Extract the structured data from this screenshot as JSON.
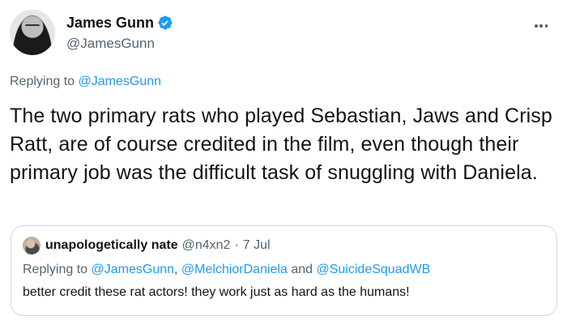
{
  "author": {
    "display_name": "James Gunn",
    "handle": "@JamesGunn",
    "verified": true,
    "avatar_icon": "profile-photo"
  },
  "more_icon": "ellipsis-icon",
  "replying": {
    "prefix": "Replying to",
    "to": "@JamesGunn"
  },
  "tweet": {
    "text": "The two primary rats who played Sebastian, Jaws and Crisp Ratt, are of course credited in the film, even though their primary job was the difficult task of snuggling with Daniela."
  },
  "quote": {
    "display_name": "unapologetically nate",
    "handle": "@n4xn2",
    "separator": "·",
    "date": "7 Jul",
    "replying_prefix": "Replying to",
    "replying_user_1": "@JamesGunn",
    "comma": ",",
    "replying_user_2": "@MelchiorDaniela",
    "and_word": "and",
    "replying_user_3": "@SuicideSquadWB",
    "text": "better credit these rat actors! they work just as hard as the humans!"
  },
  "colors": {
    "accent": "#1d9bf0",
    "text": "#0f1419",
    "secondary": "#536471",
    "border": "#cfd9de"
  }
}
